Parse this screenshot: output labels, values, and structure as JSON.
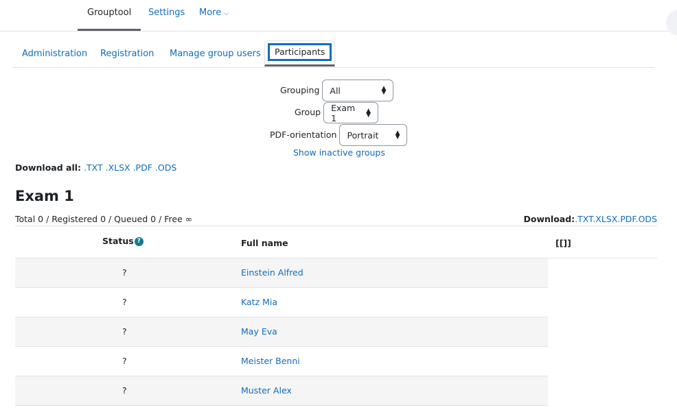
{
  "secondary_nav": {
    "items": [
      {
        "label": "Grouptool",
        "active": true
      },
      {
        "label": "Settings",
        "active": false
      },
      {
        "label": "More",
        "active": false,
        "icon": "chevron-down-icon"
      }
    ]
  },
  "tabs": [
    {
      "label": "Administration",
      "active": false
    },
    {
      "label": "Registration",
      "active": false
    },
    {
      "label": "Manage group users",
      "active": false
    },
    {
      "label": "Participants",
      "active": true
    }
  ],
  "filters": {
    "grouping": {
      "label": "Grouping",
      "value": "All"
    },
    "group": {
      "label": "Group",
      "value": "Exam 1"
    },
    "pdf_orientation": {
      "label": "PDF-orientation",
      "value": "Portrait"
    },
    "show_inactive_label": "Show inactive groups"
  },
  "download_all": {
    "label": "Download all:",
    "formats": [
      ".TXT",
      ".XLSX",
      ".PDF",
      ".ODS"
    ]
  },
  "group": {
    "title": "Exam 1",
    "totals": "Total 0 / Registered 0 / Queued 0 / Free ∞",
    "download_label": "Download:",
    "download_formats": [
      ".TXT",
      ".XLSX",
      ".PDF",
      ".ODS"
    ]
  },
  "table": {
    "headers": {
      "status": "Status",
      "full_name": "Full name",
      "extra": "[[]]"
    },
    "status_help_icon": "?",
    "rows": [
      {
        "status": "?",
        "name": "Einstein Alfred"
      },
      {
        "status": "?",
        "name": "Katz Mia"
      },
      {
        "status": "?",
        "name": "May Eva"
      },
      {
        "status": "?",
        "name": "Meister Benni"
      },
      {
        "status": "?",
        "name": "Muster Alex"
      }
    ]
  },
  "select_arrow": "⬍",
  "chevron": "⌄"
}
